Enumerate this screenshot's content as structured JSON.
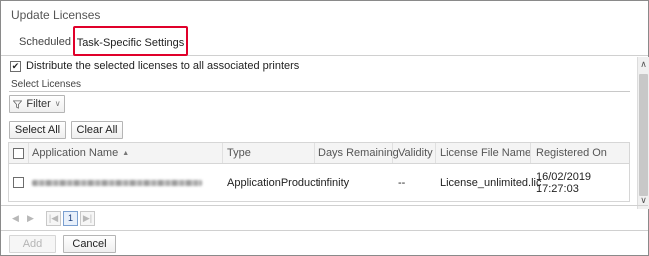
{
  "window": {
    "title": "Update Licenses"
  },
  "tabs": [
    {
      "label": "Scheduled"
    },
    {
      "label": "Task-Specific Settings"
    }
  ],
  "distribute": {
    "label": "Distribute the selected licenses to all associated printers",
    "checked": true
  },
  "select_licenses": {
    "label": "Select Licenses"
  },
  "filter": {
    "label": "Filter"
  },
  "buttons": {
    "select_all": "Select All",
    "clear_all": "Clear All",
    "add": "Add",
    "cancel": "Cancel"
  },
  "grid": {
    "columns": [
      "Application Name",
      "Type",
      "Days Remaining",
      "Validity",
      "License File Name",
      "Registered On"
    ],
    "rows": [
      {
        "type": "ApplicationProduct",
        "days_remaining": "infinity",
        "validity": "--",
        "license_file": "License_unlimited.lic",
        "registered_on": "16/02/2019 17:27:03"
      }
    ]
  },
  "pager": {
    "current_page": "1"
  },
  "highlight_color": "#e0002a"
}
